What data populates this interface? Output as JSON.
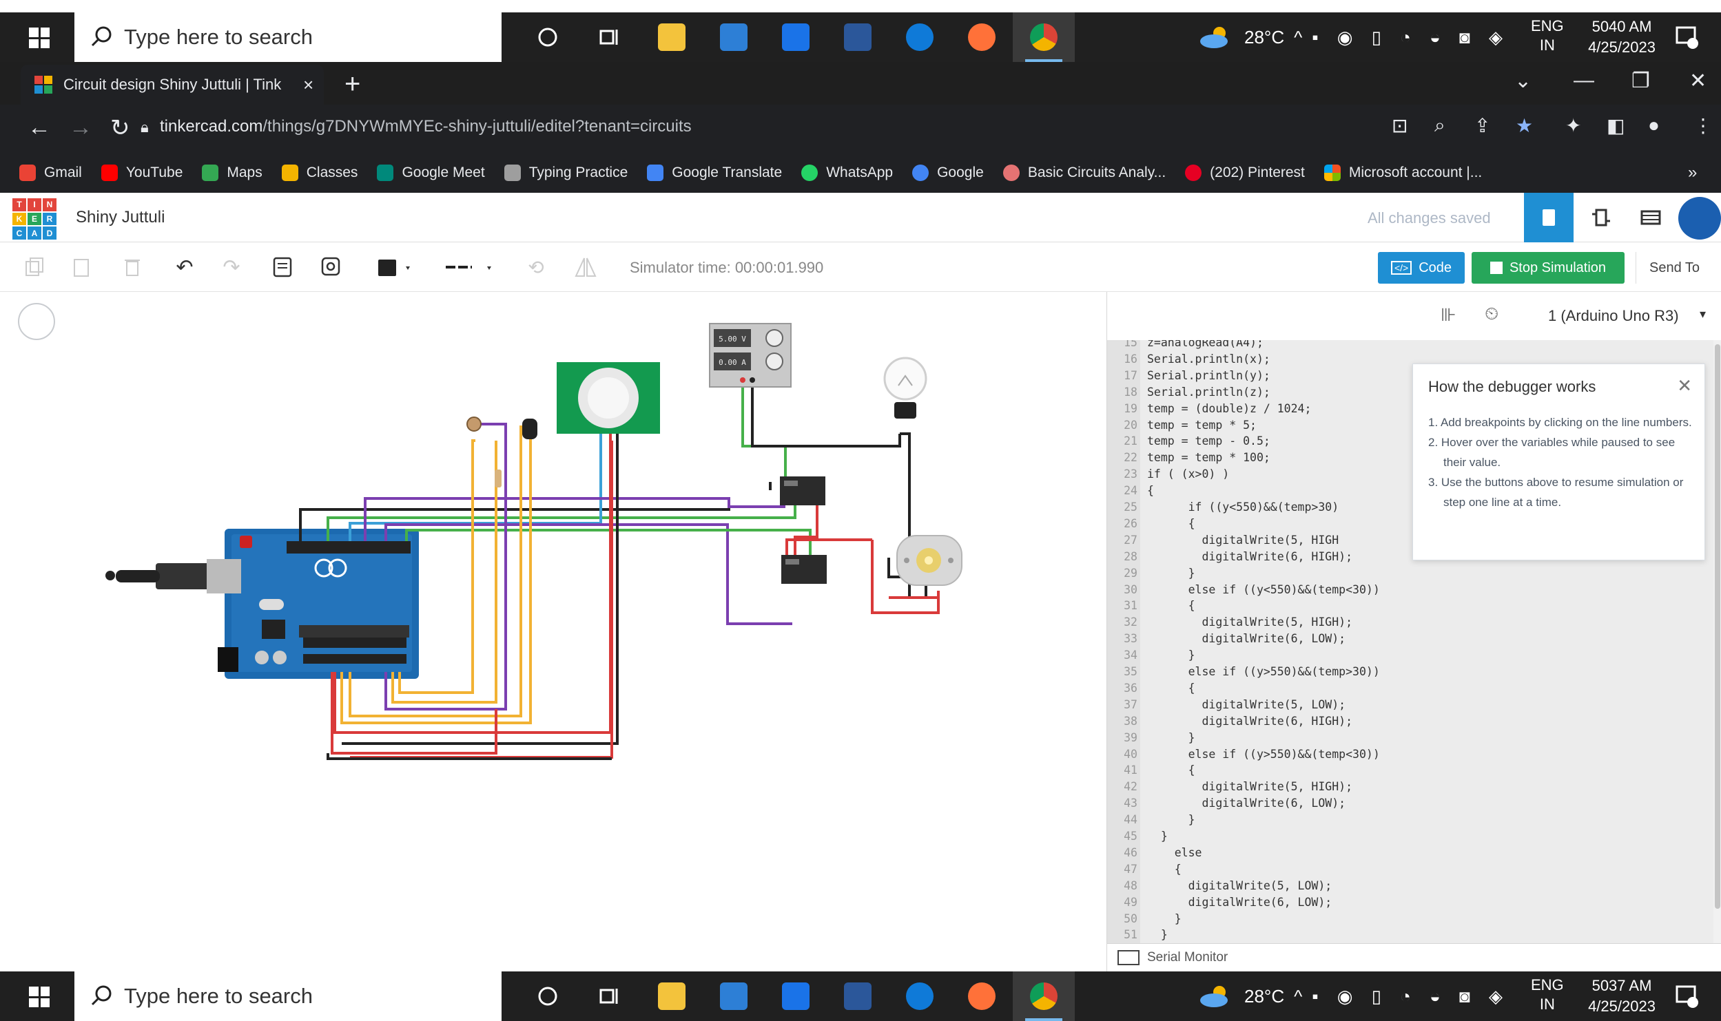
{
  "taskbar": {
    "search_placeholder": "Type here to search",
    "weather": "28°C",
    "lang_top": "ENG",
    "lang_bottom": "IN",
    "top_clock_time": "5040 AM",
    "top_clock_date": "4/25/2023",
    "bottom_clock_time": "5037 AM",
    "bottom_clock_date": "4/25/2023"
  },
  "browser": {
    "tab_title": "Circuit design Shiny Juttuli | Tink",
    "url_host": "tinkercad.com",
    "url_path": "/things/g7DNYWmMYEc-shiny-juttuli/editel?tenant=circuits",
    "bookmarks": [
      {
        "label": "Gmail",
        "color": "#ea4335"
      },
      {
        "label": "YouTube",
        "color": "#ff0000"
      },
      {
        "label": "Maps",
        "color": "#34a853"
      },
      {
        "label": "Classes",
        "color": "#f4b400"
      },
      {
        "label": "Google Meet",
        "color": "#00897b"
      },
      {
        "label": "Typing Practice",
        "color": "#9e9e9e"
      },
      {
        "label": "Google Translate",
        "color": "#4285f4"
      },
      {
        "label": "WhatsApp",
        "color": "#25d366"
      },
      {
        "label": "Google",
        "color": "#4285f4"
      },
      {
        "label": "Basic Circuits Analy...",
        "color": "#e57373"
      },
      {
        "label": "(202) Pinterest",
        "color": "#e60023"
      },
      {
        "label": "Microsoft account |...",
        "color": "#f25022"
      }
    ]
  },
  "tinkercad": {
    "project_name": "Shiny Juttuli",
    "save_status": "All changes saved",
    "sim_time": "Simulator time: 00:00:01.990",
    "code_label": "Code",
    "stop_label": "Stop Simulation",
    "send_label": "Send To",
    "device_select": "1 (Arduino Uno R3)",
    "serial_monitor": "Serial Monitor",
    "ps_voltage": "5.00 V",
    "ps_current": "0.00 A",
    "accent": "#1f8fd3",
    "stop_color": "#27a65a"
  },
  "debugger": {
    "title": "How the debugger works",
    "steps": [
      "1. Add breakpoints by clicking on the line numbers.",
      "2. Hover over the variables while paused to see their value.",
      "3. Use the buttons above to resume simulation or step one line at a time."
    ]
  },
  "code_lines": [
    {
      "n": "15",
      "t": "z=analogRead(A4);"
    },
    {
      "n": "16",
      "t": "Serial.println(x);"
    },
    {
      "n": "17",
      "t": "Serial.println(y);"
    },
    {
      "n": "18",
      "t": "Serial.println(z);"
    },
    {
      "n": "19",
      "t": "temp = (double)z / 1024;"
    },
    {
      "n": "20",
      "t": "temp = temp * 5;"
    },
    {
      "n": "21",
      "t": "temp = temp - 0.5;"
    },
    {
      "n": "22",
      "t": "temp = temp * 100;"
    },
    {
      "n": "23",
      "t": "if ( (x>0) )"
    },
    {
      "n": "24",
      "t": "{"
    },
    {
      "n": "25",
      "t": "      if ((y<550)&&(temp>30)"
    },
    {
      "n": "26",
      "t": "      {"
    },
    {
      "n": "27",
      "t": "        digitalWrite(5, HIGH"
    },
    {
      "n": "28",
      "t": "        digitalWrite(6, HIGH);"
    },
    {
      "n": "29",
      "t": "      }"
    },
    {
      "n": "30",
      "t": "      else if ((y<550)&&(temp<30))"
    },
    {
      "n": "31",
      "t": "      {"
    },
    {
      "n": "32",
      "t": "        digitalWrite(5, HIGH);"
    },
    {
      "n": "33",
      "t": "        digitalWrite(6, LOW);"
    },
    {
      "n": "34",
      "t": "      }"
    },
    {
      "n": "35",
      "t": "      else if ((y>550)&&(temp>30))"
    },
    {
      "n": "36",
      "t": "      {"
    },
    {
      "n": "37",
      "t": "        digitalWrite(5, LOW);"
    },
    {
      "n": "38",
      "t": "        digitalWrite(6, HIGH);"
    },
    {
      "n": "39",
      "t": "      }"
    },
    {
      "n": "40",
      "t": "      else if ((y>550)&&(temp<30))"
    },
    {
      "n": "41",
      "t": "      {"
    },
    {
      "n": "42",
      "t": "        digitalWrite(5, HIGH);"
    },
    {
      "n": "43",
      "t": "        digitalWrite(6, LOW);"
    },
    {
      "n": "44",
      "t": "      }"
    },
    {
      "n": "45",
      "t": "  }"
    },
    {
      "n": "46",
      "t": "    else"
    },
    {
      "n": "47",
      "t": "    {"
    },
    {
      "n": "48",
      "t": "      digitalWrite(5, LOW);"
    },
    {
      "n": "49",
      "t": "      digitalWrite(6, LOW);"
    },
    {
      "n": "50",
      "t": "    }"
    },
    {
      "n": "51",
      "t": "  }"
    }
  ]
}
